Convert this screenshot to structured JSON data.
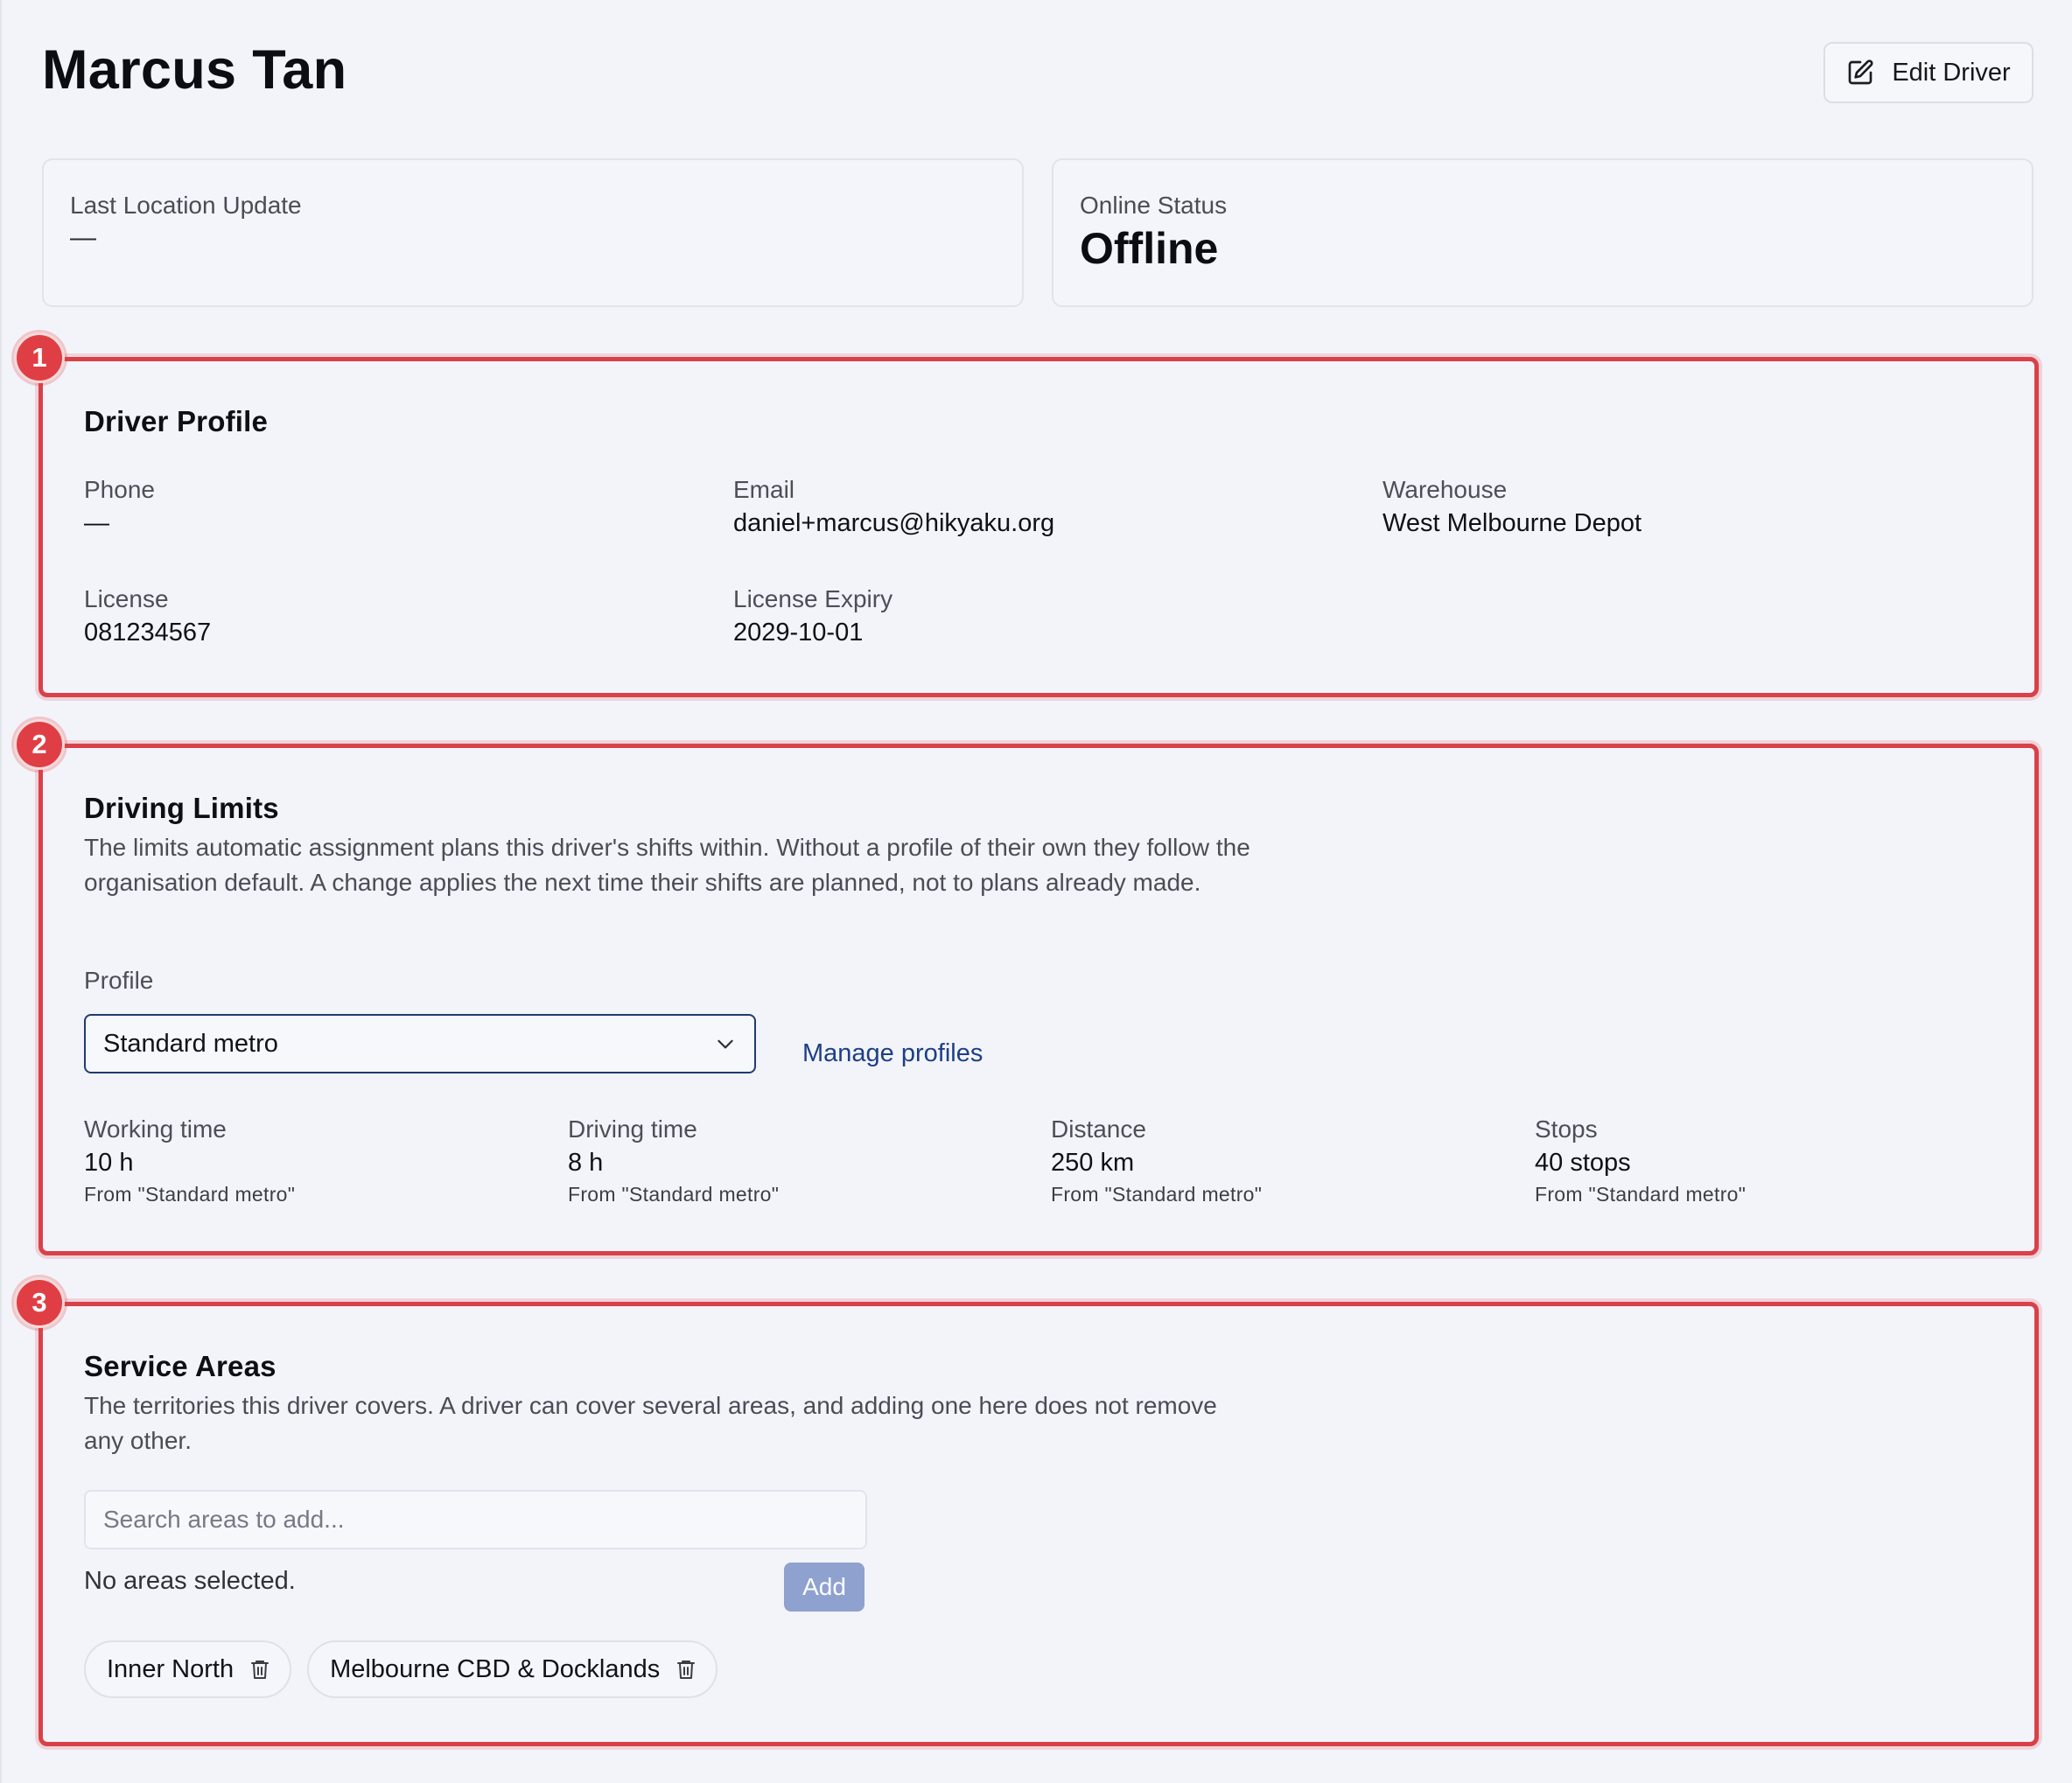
{
  "header": {
    "title": "Marcus Tan",
    "edit_label": "Edit Driver"
  },
  "stats": {
    "last_location": {
      "label": "Last Location Update",
      "value": "—"
    },
    "online_status": {
      "label": "Online Status",
      "value": "Offline"
    }
  },
  "sections": {
    "profile": {
      "badge": "1",
      "title": "Driver Profile",
      "fields": {
        "phone": {
          "label": "Phone",
          "value": "—"
        },
        "email": {
          "label": "Email",
          "value": "daniel+marcus@hikyaku.org"
        },
        "warehouse": {
          "label": "Warehouse",
          "value": "West Melbourne Depot"
        },
        "license": {
          "label": "License",
          "value": "081234567"
        },
        "license_expiry": {
          "label": "License Expiry",
          "value": "2029-10-01"
        }
      }
    },
    "limits": {
      "badge": "2",
      "title": "Driving Limits",
      "description": "The limits automatic assignment plans this driver's shifts within. Without a profile of their own they follow the organisation default. A change applies the next time their shifts are planned, not to plans already made.",
      "profile_label": "Profile",
      "profile_value": "Standard metro",
      "manage_link": "Manage profiles",
      "metrics": [
        {
          "label": "Working time",
          "value": "10 h",
          "note": "From \"Standard metro\""
        },
        {
          "label": "Driving time",
          "value": "8 h",
          "note": "From \"Standard metro\""
        },
        {
          "label": "Distance",
          "value": "250 km",
          "note": "From \"Standard metro\""
        },
        {
          "label": "Stops",
          "value": "40 stops",
          "note": "From \"Standard metro\""
        }
      ]
    },
    "areas": {
      "badge": "3",
      "title": "Service Areas",
      "description": "The territories this driver covers. A driver can cover several areas, and adding one here does not remove any other.",
      "search_placeholder": "Search areas to add...",
      "empty_text": "No areas selected.",
      "add_label": "Add",
      "chips": [
        "Inner North",
        "Melbourne CBD & Docklands"
      ]
    }
  },
  "colors": {
    "highlight": "#d9414a",
    "link": "#1d3f86",
    "add_button": "#8ea1cf"
  }
}
